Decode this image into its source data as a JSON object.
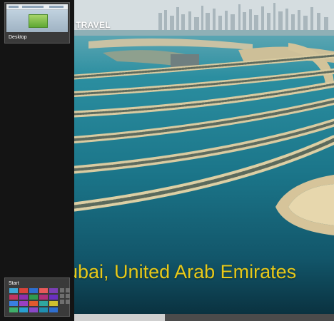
{
  "app_switcher": {
    "items": [
      {
        "label": "Desktop"
      },
      {
        "label": "Start"
      }
    ],
    "start_tile_colors": [
      "#3fa7d6",
      "#d9443b",
      "#2e6fd0",
      "#e85a5a",
      "#7b3fb5",
      "#c3335f",
      "#8c2fb0",
      "#2f9b4f",
      "#b02f7a",
      "#6a2fc0",
      "#3a7fe0",
      "#9a3fc3",
      "#e05a2f",
      "#2fa8a0",
      "#d0c030",
      "#3fb06a",
      "#28a0d0",
      "#8a48c8",
      "#1f8fb0",
      "#2f6fd0"
    ]
  },
  "main": {
    "section_label": "TRAVEL",
    "location": "ubai, United Arab Emirates",
    "water_color": "#1f7d90",
    "accent_color": "#e8c918"
  },
  "scrollbar": {
    "position": 0.35
  }
}
